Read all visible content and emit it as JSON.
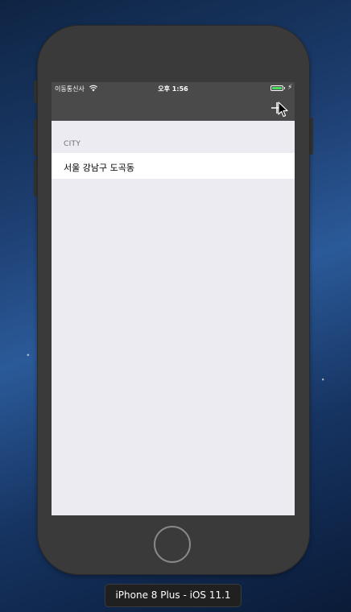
{
  "status_bar": {
    "carrier": "이동통신사",
    "time": "오후 1:56",
    "battery_color": "#4cd964"
  },
  "nav_bar": {
    "add_icon": "plus-icon"
  },
  "table": {
    "section_header": "CITY",
    "rows": [
      {
        "label": "서울 강남구 도곡동"
      }
    ]
  },
  "simulator": {
    "device_label": "iPhone 8 Plus - iOS 11.1"
  },
  "colors": {
    "nav_background": "#4a4a4a",
    "table_background": "#ebebf1",
    "cell_background": "#ffffff"
  }
}
